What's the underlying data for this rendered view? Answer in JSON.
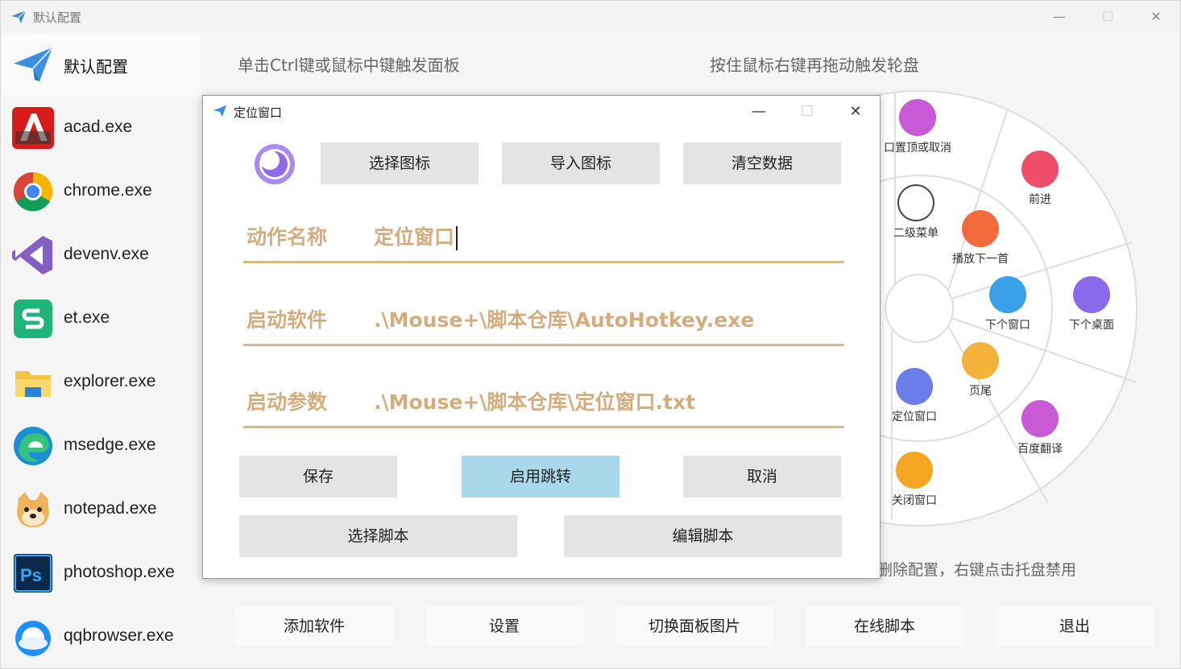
{
  "window": {
    "title": "默认配置",
    "minimize": "—",
    "maximize": "☐",
    "close": "✕"
  },
  "sidebar": {
    "profile_label": "默认配置",
    "apps": [
      {
        "label": "acad.exe",
        "icon": "autocad-icon"
      },
      {
        "label": "chrome.exe",
        "icon": "chrome-icon"
      },
      {
        "label": "devenv.exe",
        "icon": "visual-studio-icon"
      },
      {
        "label": "et.exe",
        "icon": "wps-sheet-icon"
      },
      {
        "label": "explorer.exe",
        "icon": "folder-icon"
      },
      {
        "label": "msedge.exe",
        "icon": "edge-icon"
      },
      {
        "label": "notepad.exe",
        "icon": "doge-icon"
      },
      {
        "label": "photoshop.exe",
        "icon": "photoshop-icon"
      },
      {
        "label": "qqbrowser.exe",
        "icon": "qq-browser-icon"
      }
    ]
  },
  "hints": {
    "left": "单击Ctrl键或鼠标中键触发面板",
    "right": "按住鼠标右键再拖动触发轮盘",
    "footer": "删除配置，右键点击托盘禁用"
  },
  "wheel": {
    "items": [
      {
        "label": "口置顶或取消",
        "color": "#c95ad6"
      },
      {
        "label": "前进",
        "color": "#ef4e6a"
      },
      {
        "label": "二级菜单",
        "color": "#ffffff"
      },
      {
        "label": "播放下一首",
        "color": "#f36b3d"
      },
      {
        "label": "下个窗口",
        "color": "#3aa1e8"
      },
      {
        "label": "下个桌面",
        "color": "#8a6ae8"
      },
      {
        "label": "页尾",
        "color": "#f4b23a"
      },
      {
        "label": "定位窗口",
        "color": "#6a7de8"
      },
      {
        "label": "百度翻译",
        "color": "#c95ad6"
      },
      {
        "label": "关闭窗口",
        "color": "#f5a623"
      }
    ]
  },
  "bottom_buttons": [
    "添加软件",
    "设置",
    "切换面板图片",
    "在线脚本",
    "退出"
  ],
  "dialog": {
    "title": "定位窗口",
    "minimize": "—",
    "maximize": "☐",
    "close": "✕",
    "top_buttons": [
      "选择图标",
      "导入图标",
      "清空数据"
    ],
    "fields": [
      {
        "label": "动作名称",
        "value": "定位窗口"
      },
      {
        "label": "启动软件",
        "value": ".\\Mouse+\\脚本仓库\\AutoHotkey.exe"
      },
      {
        "label": "启动参数",
        "value": ".\\Mouse+\\脚本仓库\\定位窗口.txt"
      }
    ],
    "actions_row1": [
      "保存",
      "启用跳转",
      "取消"
    ],
    "actions_row2": [
      "选择脚本",
      "编辑脚本"
    ]
  },
  "colors": {
    "accent_field": "#d4ad7e",
    "primary_button": "#a8d8ea",
    "gray_button": "#e4e4e4"
  }
}
